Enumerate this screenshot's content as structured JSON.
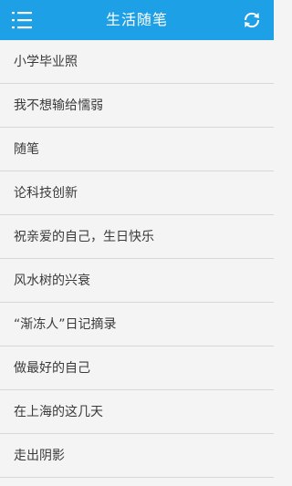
{
  "header": {
    "title": "生活随笔",
    "menu_icon": "menu-icon",
    "refresh_icon": "refresh-icon",
    "color": "#1ea0e6"
  },
  "list": {
    "items": [
      {
        "label": "小学毕业照"
      },
      {
        "label": "我不想输给懦弱"
      },
      {
        "label": "随笔"
      },
      {
        "label": "论科技创新"
      },
      {
        "label": "祝亲爱的自己，生日快乐"
      },
      {
        "label": "风水树的兴衰"
      },
      {
        "label": "“渐冻人”日记摘录"
      },
      {
        "label": "做最好的自己"
      },
      {
        "label": "在上海的这几天"
      },
      {
        "label": "走出阴影"
      }
    ]
  }
}
